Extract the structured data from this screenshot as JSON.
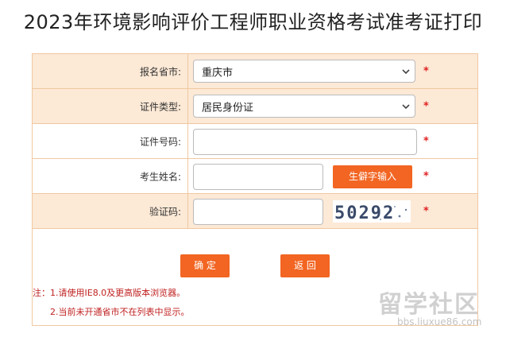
{
  "page": {
    "title": "2023年环境影响评价工程师职业资格考试准考证打印"
  },
  "form": {
    "province": {
      "label": "报名省市:",
      "selected": "重庆市"
    },
    "id_type": {
      "label": "证件类型:",
      "selected": "居民身份证"
    },
    "id_number": {
      "label": "证件号码:",
      "value": ""
    },
    "name": {
      "label": "考生姓名:",
      "value": "",
      "rare_char_button": "生僻字输入"
    },
    "captcha": {
      "label": "验证码:",
      "value": "",
      "image_text": "50292"
    },
    "required_mark": "*"
  },
  "actions": {
    "confirm": "确 定",
    "back": "返 回"
  },
  "notes": {
    "note1": "注：1.请使用IE8.0及更高版本浏览器。",
    "note2": "2.当前未开通省市不在列表中显示。"
  },
  "watermark": {
    "text": "留学社区",
    "url": "bbs.liuxue86.com"
  },
  "colors": {
    "accent": "#f26522",
    "row_shade": "#fce9d6",
    "border": "#f0c8a0",
    "required": "#e02020"
  }
}
